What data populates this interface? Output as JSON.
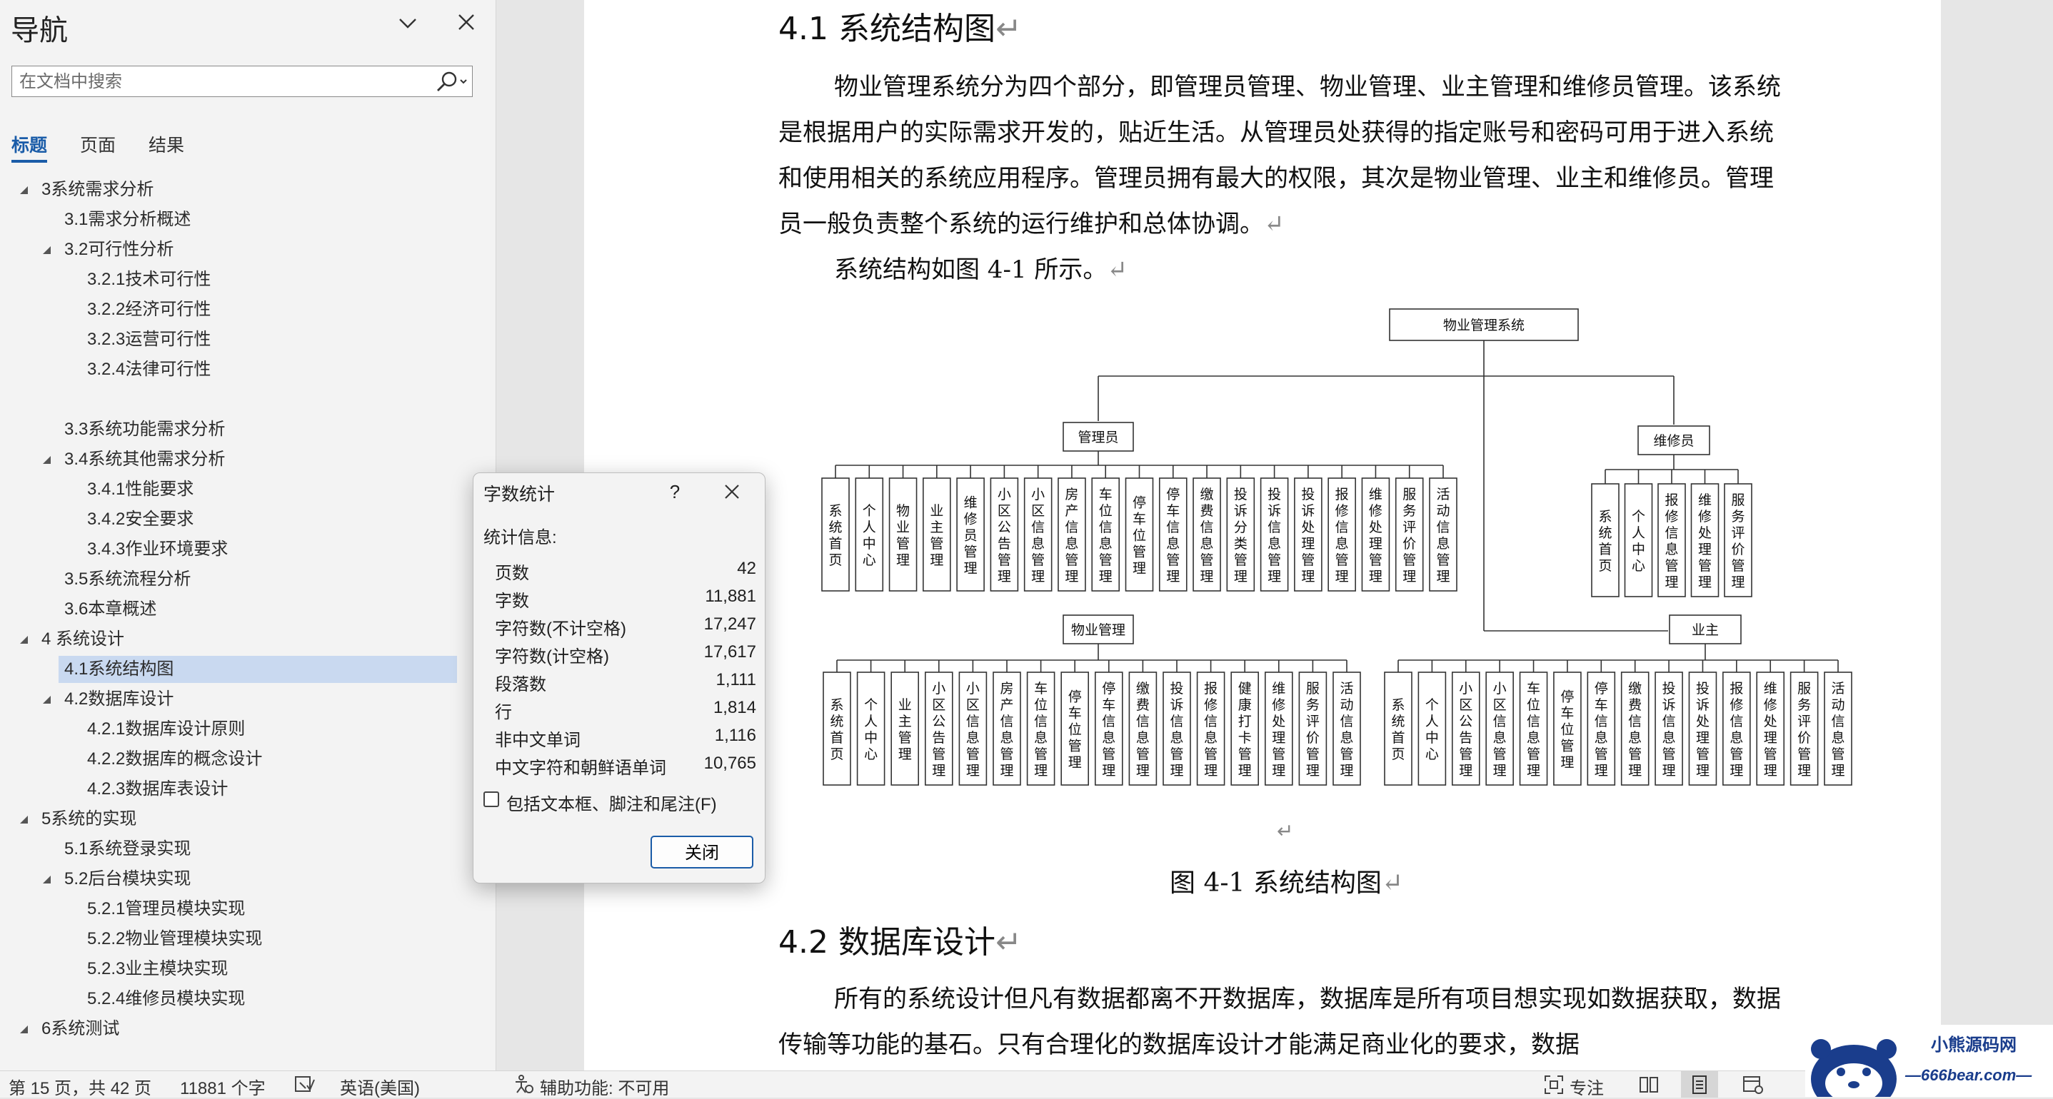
{
  "nav": {
    "title": "导航",
    "search_placeholder": "在文档中搜索",
    "tabs": [
      "标题",
      "页面",
      "结果"
    ],
    "outline": [
      {
        "text": "3系统需求分析",
        "level": 1,
        "expanded": true
      },
      {
        "text": "3.1需求分析概述",
        "level": 2
      },
      {
        "text": "3.2可行性分析",
        "level": 2,
        "expanded": true
      },
      {
        "text": "3.2.1技术可行性",
        "level": 3
      },
      {
        "text": "3.2.2经济可行性",
        "level": 3
      },
      {
        "text": "3.2.3运营可行性",
        "level": 3
      },
      {
        "text": "3.2.4法律可行性",
        "level": 3
      },
      {
        "text": "",
        "level": 3
      },
      {
        "text": "3.3系统功能需求分析",
        "level": 2
      },
      {
        "text": "3.4系统其他需求分析",
        "level": 2,
        "expanded": true
      },
      {
        "text": "3.4.1性能要求",
        "level": 3
      },
      {
        "text": "3.4.2安全要求",
        "level": 3
      },
      {
        "text": "3.4.3作业环境要求",
        "level": 3
      },
      {
        "text": "3.5系统流程分析",
        "level": 2
      },
      {
        "text": "3.6本章概述",
        "level": 2
      },
      {
        "text": "4 系统设计",
        "level": 1,
        "expanded": true
      },
      {
        "text": "4.1系统结构图",
        "level": 2,
        "selected": true
      },
      {
        "text": "4.2数据库设计",
        "level": 2,
        "expanded": true
      },
      {
        "text": "4.2.1数据库设计原则",
        "level": 3
      },
      {
        "text": "4.2.2数据库的概念设计",
        "level": 3
      },
      {
        "text": "4.2.3数据库表设计",
        "level": 3
      },
      {
        "text": "5系统的实现",
        "level": 1,
        "expanded": true
      },
      {
        "text": "5.1系统登录实现",
        "level": 2
      },
      {
        "text": "5.2后台模块实现",
        "level": 2,
        "expanded": true
      },
      {
        "text": "5.2.1管理员模块实现",
        "level": 3
      },
      {
        "text": "5.2.2物业管理模块实现",
        "level": 3
      },
      {
        "text": "5.2.3业主模块实现",
        "level": 3
      },
      {
        "text": "5.2.4维修员模块实现",
        "level": 3
      },
      {
        "text": "6系统测试",
        "level": 1,
        "expanded": true
      }
    ]
  },
  "doc": {
    "heading1": "4.1 系统结构图",
    "para1": "物业管理系统分为四个部分，即管理员管理、物业管理、业主管理和维修员管理。该系统是根据用户的实际需求开发的，贴近生活。从管理员处获得的指定账号和密码可用于进入系统和使用相关的系统应用程序。管理员拥有最大的权限，其次是物业管理、业主和维修员。管理员一般负责整个系统的运行维护和总体协调。",
    "para2": "系统结构如图 4-1 所示。",
    "caption": "图 4-1 系统结构图",
    "heading2": "4.2 数据库设计",
    "para3": "所有的系统设计但凡有数据都离不开数据库，数据库是所有项目想实现如数据获取，数据传输等功能的基石。只有合理化的数据库设计才能满足商业化的要求，数据",
    "para_mark": "↵"
  },
  "diagram": {
    "root": "物业管理系统",
    "groups": [
      {
        "name": "管理员",
        "leaves": [
          "系统首页",
          "个人中心",
          "物业管理",
          "业主管理",
          "维修员管理",
          "小区公告管理",
          "小区信息管理",
          "房产信息管理",
          "车位信息管理",
          "停车位管理",
          "停车信息管理",
          "缴费信息管理",
          "投诉分类管理",
          "投诉信息管理",
          "投诉处理管理",
          "报修信息管理",
          "维修处理管理",
          "服务评价管理",
          "活动信息管理"
        ]
      },
      {
        "name": "维修员",
        "leaves": [
          "系统首页",
          "个人中心",
          "报修信息管理",
          "维修处理管理",
          "服务评价管理"
        ]
      },
      {
        "name": "物业管理",
        "leaves": [
          "系统首页",
          "个人中心",
          "业主管理",
          "小区公告管理",
          "小区信息管理",
          "房产信息管理",
          "车位信息管理",
          "停车位管理",
          "停车信息管理",
          "缴费信息管理",
          "投诉信息管理",
          "报修信息管理",
          "健康打卡管理",
          "维修处理管理",
          "服务评价管理",
          "活动信息管理"
        ]
      },
      {
        "name": "业主",
        "leaves": [
          "系统首页",
          "个人中心",
          "小区公告管理",
          "小区信息管理",
          "车位信息管理",
          "停车位管理",
          "停车信息管理",
          "缴费信息管理",
          "投诉信息管理",
          "投诉处理管理",
          "报修信息管理",
          "维修处理管理",
          "服务评价管理",
          "活动信息管理"
        ]
      }
    ]
  },
  "dialog": {
    "title": "字数统计",
    "help": "?",
    "stats_label": "统计信息:",
    "stats": [
      {
        "label": "页数",
        "value": "42"
      },
      {
        "label": "字数",
        "value": "11,881"
      },
      {
        "label": "字符数(不计空格)",
        "value": "17,247"
      },
      {
        "label": "字符数(计空格)",
        "value": "17,617"
      },
      {
        "label": "段落数",
        "value": "1,111"
      },
      {
        "label": "行",
        "value": "1,814"
      },
      {
        "label": "非中文单词",
        "value": "1,116"
      },
      {
        "label": "中文字符和朝鲜语单词",
        "value": "10,765"
      }
    ],
    "checkbox_label": "包括文本框、脚注和尾注(F)",
    "checkbox_checked": false,
    "close_label": "关闭"
  },
  "status": {
    "page": "第 15 页，共 42 页",
    "words": "11881 个字",
    "language": "英语(美国)",
    "accessibility": "辅助功能: 不可用",
    "focus": "专注"
  },
  "watermark": {
    "title": "小熊源码网",
    "url": "—666bear.com—"
  }
}
